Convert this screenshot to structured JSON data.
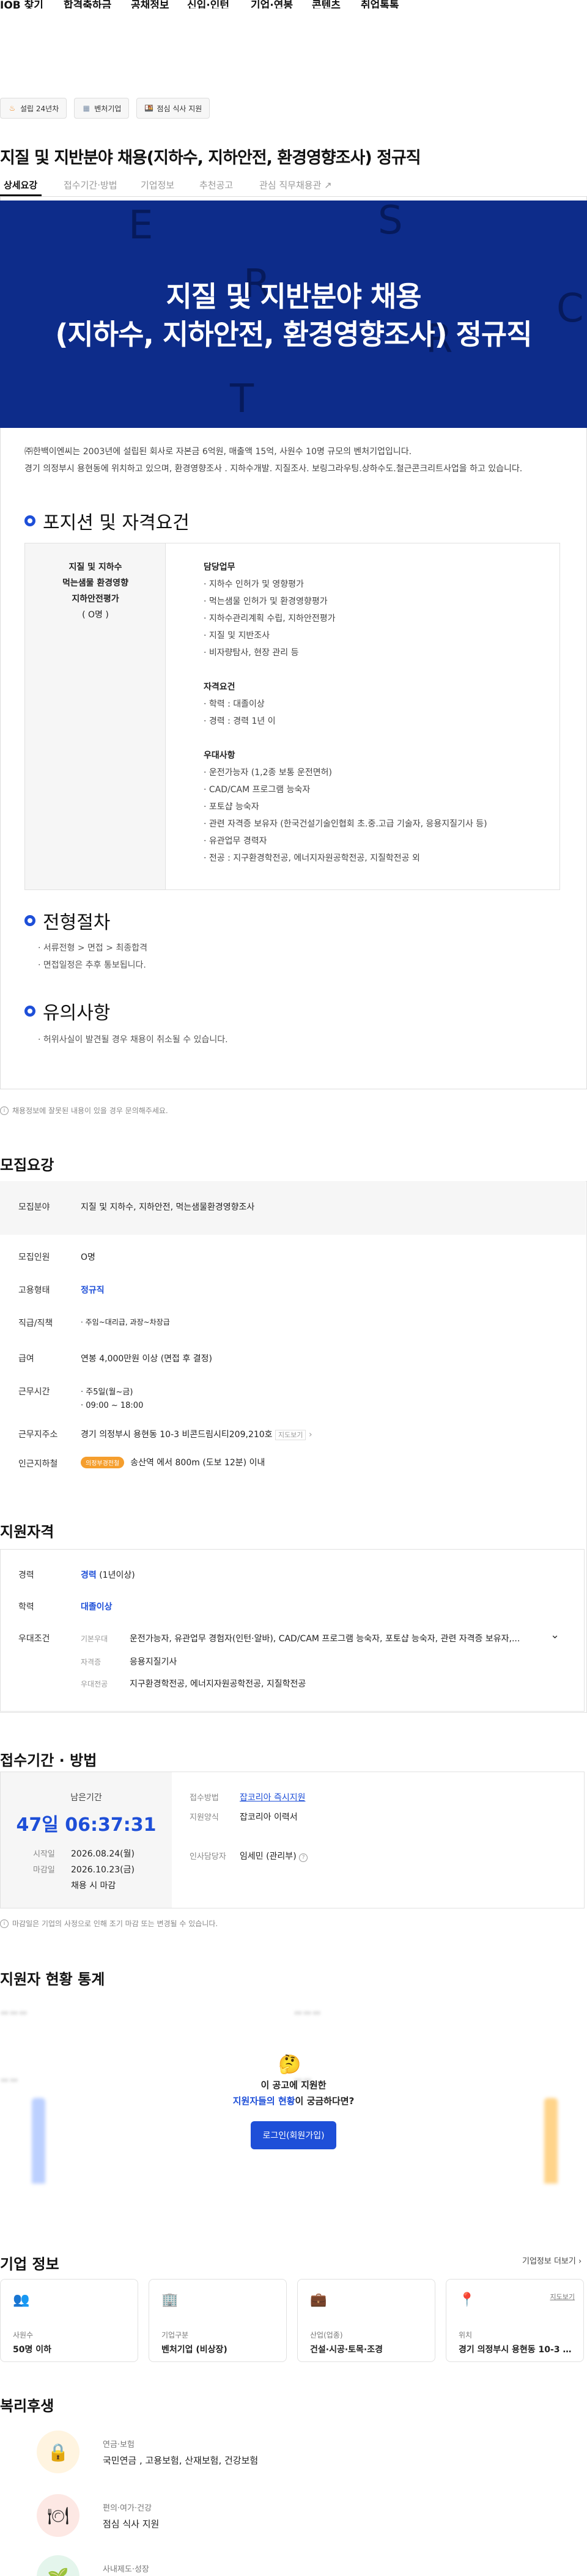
{
  "nav": {
    "items": [
      "JOB 찾기",
      "합격축하금",
      "공채정보",
      "신입·인턴",
      "기업·연봉",
      "콘텐츠",
      "취업톡톡"
    ]
  },
  "chips": [
    {
      "icon": "flame-icon",
      "label": "설립 24년차"
    },
    {
      "icon": "building-icon",
      "label": "벤처기업"
    },
    {
      "icon": "meal-icon",
      "label": "점심 식사 지원"
    }
  ],
  "job": {
    "title": "지질 및 지반분야 채용(지하수, 지하안전, 환경영향조사) 정규직"
  },
  "tabs": [
    "상세요강",
    "접수기간·방법",
    "기업정보",
    "추천공고",
    "관심 직무채용관"
  ],
  "banner": {
    "line1": "지질 및 지반분야 채용",
    "line2": "(지하수, 지하안전, 환경영향조사) 정규직",
    "letters": [
      "E",
      "S",
      "R",
      "C",
      "R",
      "T"
    ]
  },
  "intro": [
    "㈜한백이엔씨는 2003년에 설립된 회사로 자본금 6억원, 매출액 15억, 사원수 10명 규모의 벤처기업입니다.",
    "경기 의정부시 용현동에 위치하고 있으며, 환경영향조사 . 지하수개발. 지질조사. 보링그라우팅.상하수도.철근콘크리트사업을 하고 있습니다."
  ],
  "position": {
    "heading": "포지션 및 자격요건",
    "left": [
      "지질 및 지하수",
      "먹는샘물 환경영향",
      "지하안전평가",
      "( O명 )"
    ],
    "duty_title": "담당업무",
    "duties": [
      "지하수 인허가 및 영향평가",
      "먹는샘물 인허가 및 환경영향평가",
      "지하수관리계획 수립, 지하안전평가",
      "지질 및 지반조사",
      "비자량탐사, 현장 관리 등"
    ],
    "qual_title": "자격요건",
    "quals": [
      "학력 : 대졸이상",
      "경력 : 경력 1년 이"
    ],
    "pref_title": "우대사항",
    "prefs": [
      "운전가능자 (1,2종 보통 운전면허)",
      "CAD/CAM 프로그램 능숙자",
      "포토샵 능숙자",
      "관련 자격증 보유자 (한국건설기술인협회 초.중.고급 기술자, 응용지질기사 등)",
      "유관업무 경력자",
      "전공 : 지구환경학전공, 에너지자원공학전공, 지질학전공 외"
    ]
  },
  "process": {
    "heading": "전형절차",
    "items": [
      "서류전형 > 면접 > 최종합격",
      "면접일정은 추후 통보됩니다."
    ]
  },
  "caution": {
    "heading": "유의사항",
    "items": [
      "허위사실이 발견될 경우 채용이 취소될 수 있습니다."
    ]
  },
  "notice1": "채용정보에 잘못된 내용이 있을 경우 문의해주세요.",
  "recruit": {
    "heading": "모집요강",
    "rows": [
      {
        "label": "모집분야",
        "value": "지질 및 지하수, 지하안전, 먹는샘물환경영향조사"
      },
      {
        "label": "모집인원",
        "value": "O명"
      },
      {
        "label": "고용형태",
        "value": "정규직"
      },
      {
        "label": "직급/직책",
        "value": "주임~대리급, 과장~차장급"
      },
      {
        "label": "급여",
        "value": "연봉 4,000만원 이상 (면접 후 결정)"
      },
      {
        "label": "근무시간",
        "value": "주5일(월~금)"
      },
      {
        "label": "",
        "value": "09:00 ~ 18:00"
      },
      {
        "label": "근무지주소",
        "value": "경기 의정부시 용현동 10-3 비콘드림시티209,210호",
        "extra": "지도보기"
      },
      {
        "label": "인근지하철",
        "value": "송산역 에서 800m (도보 12분) 이내",
        "badge": "의정부경전철"
      }
    ]
  },
  "qualify": {
    "heading": "지원자격",
    "career_label": "경력",
    "career": "경력",
    "career_sub": "(1년이상)",
    "edu_label": "학력",
    "edu": "대졸이상",
    "pref_label": "우대조건",
    "prefs": [
      {
        "k": "기본우대",
        "v": "운전가능자, 유관업무 경험자(인턴·알바), CAD/CAM 프로그램 능숙자, 포토샵 능숙자, 관련 자격증 보유자,..."
      },
      {
        "k": "자격증",
        "v": "응용지질기사"
      },
      {
        "k": "우대전공",
        "v": "지구환경학전공, 에너지자원공학전공, 지질학전공"
      }
    ]
  },
  "apply": {
    "heading": "접수기간 · 방법",
    "remain_label": "남은기간",
    "remain": "47일 06:37:31",
    "start_label": "시작일",
    "start": "2026.08.24(월)",
    "end_label": "마감일",
    "end": "2026.10.23(금)",
    "note": "채용 시 마감",
    "method_label": "접수방법",
    "method": "잡코리아 즉시지원",
    "form_label": "지원양식",
    "form": "잡코리아 이력서",
    "hr_label": "인사담당자",
    "hr": "임세민 (관리부)"
  },
  "notice2": "마감일은 기업의 사정으로 인해 조기 마감 또는 변경될 수 있습니다.",
  "stats": {
    "heading": "지원자 현황 통계",
    "emoji": "🤔",
    "line1": "이 공고에 지원한",
    "line2a": "지원자들의 현황",
    "line2b": "이 궁금하다면?",
    "login": "로그인(회원가입)"
  },
  "company": {
    "heading": "기업 정보",
    "more": "기업정보 더보기",
    "cards": [
      {
        "icon": "people-icon",
        "label": "사원수",
        "value": "50명 이하"
      },
      {
        "icon": "office-icon",
        "label": "기업구분",
        "value": "벤처기업 (비상장)"
      },
      {
        "icon": "briefcase-icon",
        "label": "산업(업종)",
        "value": "건설·시공·토목·조경"
      },
      {
        "icon": "pin-icon",
        "label": "위치",
        "value": "경기 의정부시 용현동 10-3 비콘...",
        "link": "지도보기"
      }
    ]
  },
  "welfare": {
    "heading": "복리후생",
    "items": [
      {
        "label": "연금·보험",
        "value": "국민연금 , 고용보험, 산재보험, 건강보험"
      },
      {
        "label": "편의·여가·건강",
        "value": "점심 식사 지원"
      },
      {
        "label": "사내제도·성장",
        "value": ""
      }
    ]
  }
}
